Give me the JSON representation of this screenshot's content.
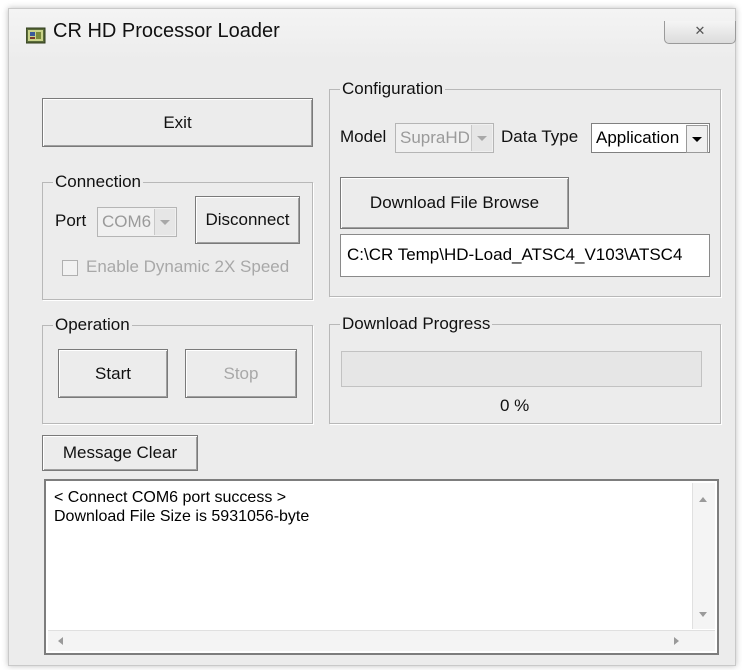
{
  "window": {
    "title": "CR HD Processor Loader",
    "close_icon": "close-icon"
  },
  "buttons": {
    "exit": "Exit",
    "disconnect": "Disconnect",
    "start": "Start",
    "stop": "Stop",
    "download_file_browse": "Download File Browse",
    "message_clear": "Message Clear"
  },
  "connection": {
    "group_label": "Connection",
    "port_label": "Port",
    "port_value": "COM6",
    "dynamic_speed_label": "Enable Dynamic 2X Speed",
    "dynamic_speed_checked": false
  },
  "configuration": {
    "group_label": "Configuration",
    "model_label": "Model",
    "model_value": "SupraHD",
    "data_type_label": "Data Type",
    "data_type_value": "Application",
    "file_path": "C:\\CR Temp\\HD-Load_ATSC4_V103\\ATSC4"
  },
  "operation": {
    "group_label": "Operation"
  },
  "download_progress": {
    "group_label": "Download Progress",
    "percent": 0,
    "percent_text": "0 %"
  },
  "messages": [
    "< Connect COM6 port success >",
    "Download File Size is 5931056-byte"
  ],
  "colors": {
    "window_bg": "#ececec",
    "progress_fill": "#3cb043"
  }
}
